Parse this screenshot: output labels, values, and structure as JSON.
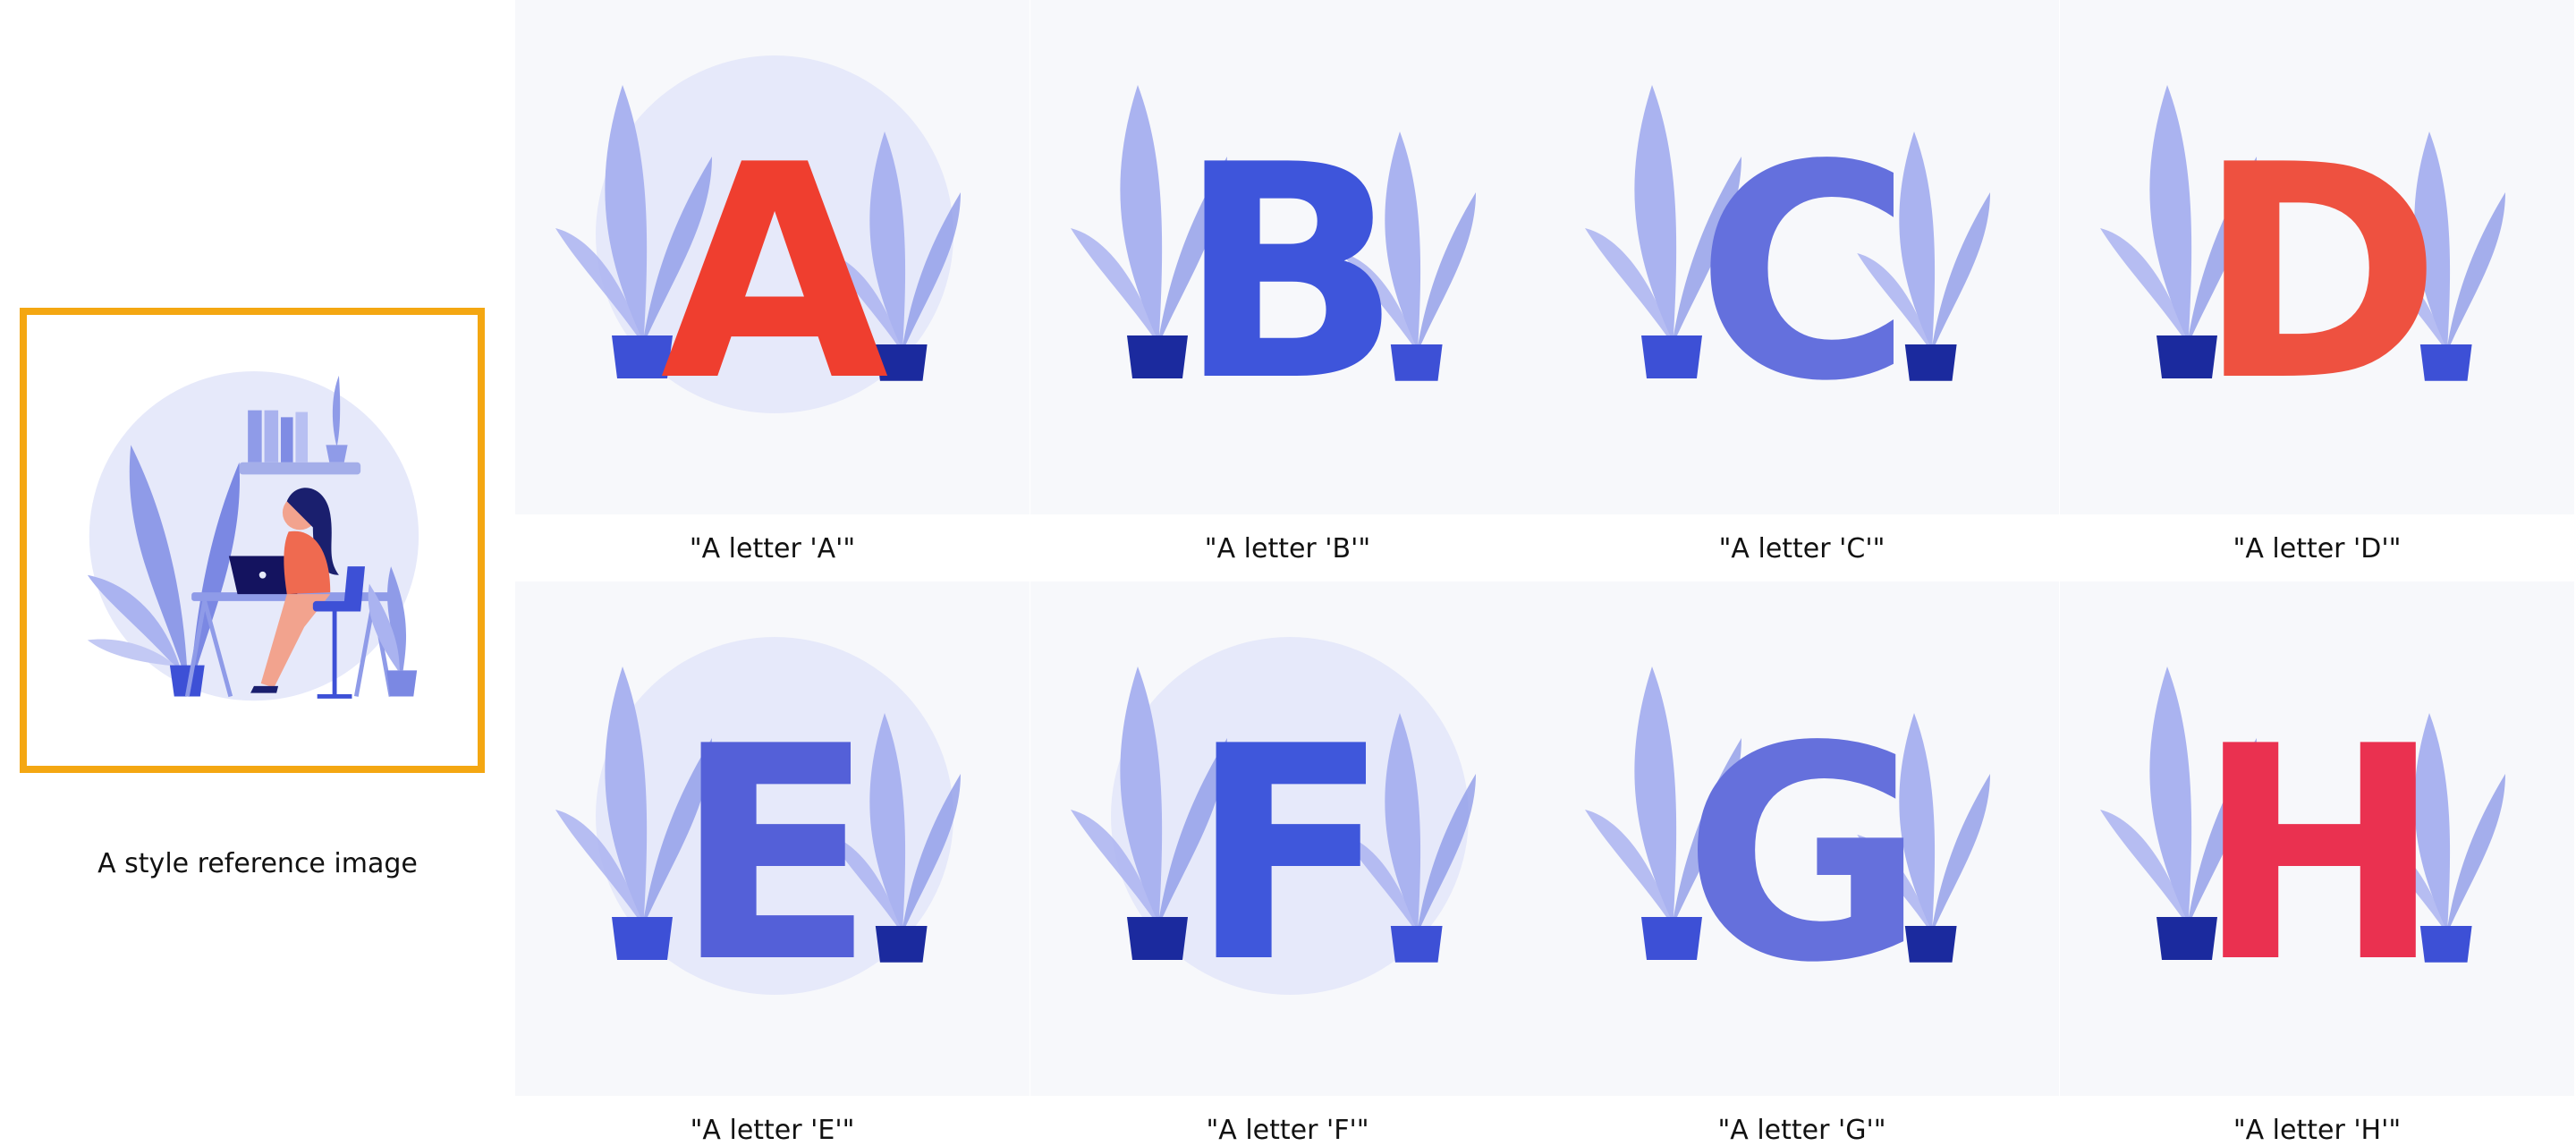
{
  "reference": {
    "caption": "A style reference image"
  },
  "grid": [
    {
      "letter": "A",
      "caption": "\"A letter 'A'\"",
      "color": "#ef3e2f"
    },
    {
      "letter": "B",
      "caption": "\"A letter 'B'\"",
      "color": "#3e55db"
    },
    {
      "letter": "C",
      "caption": "\"A letter 'C'\"",
      "color": "#6470dd"
    },
    {
      "letter": "D",
      "caption": "\"A letter 'D'\"",
      "color": "#ee5140"
    },
    {
      "letter": "E",
      "caption": "\"A letter 'E'\"",
      "color": "#5460d8"
    },
    {
      "letter": "F",
      "caption": "\"A letter 'F'\"",
      "color": "#3f57db"
    },
    {
      "letter": "G",
      "caption": "\"A letter 'G'\"",
      "color": "#6570dc"
    },
    {
      "letter": "H",
      "caption": "\"A letter 'H'\"",
      "color": "#ea3150"
    }
  ],
  "colors": {
    "frame": "#f4a712",
    "leaf": "#aab3f0",
    "leaf_dark": "#8f9be8",
    "pot_dark": "#1b2a9e",
    "pot": "#3d50d6",
    "halo": "#e6e9fa"
  }
}
